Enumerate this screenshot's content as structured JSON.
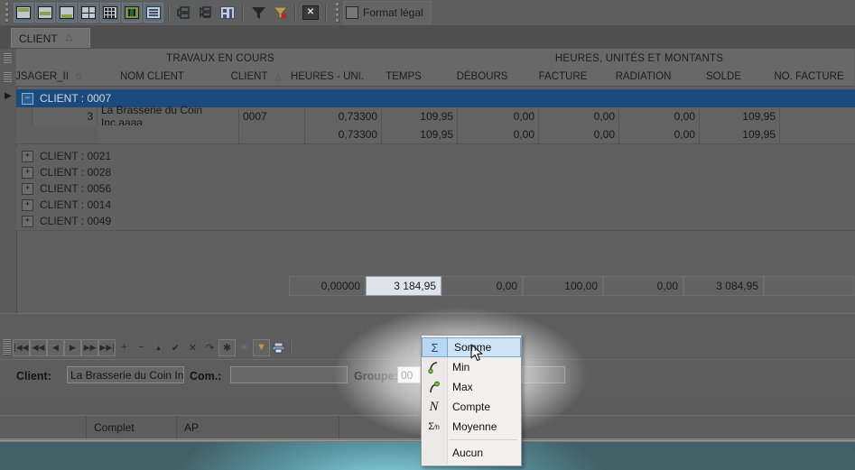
{
  "toolbar": {
    "icons": [
      {
        "name": "layout-top-band-icon",
        "framed": true
      },
      {
        "name": "layout-middle-band-icon",
        "framed": true
      },
      {
        "name": "layout-bottom-band-icon",
        "framed": true
      },
      {
        "name": "grid-quad-icon",
        "framed": true
      },
      {
        "name": "grid-dots-icon",
        "framed": true
      },
      {
        "name": "fit-width-icon",
        "framed": true
      },
      {
        "name": "list-lines-icon",
        "framed": true
      },
      {
        "name": "group-by-box-icon",
        "framed": false
      },
      {
        "name": "tree-outline-icon",
        "framed": false
      },
      {
        "name": "card-view-icon",
        "framed": false
      },
      {
        "name": "filter-icon",
        "framed": false
      },
      {
        "name": "filter-clear-icon",
        "framed": false
      },
      {
        "name": "close-x-icon",
        "framed": false
      }
    ],
    "format_legal_label": "Format légal",
    "format_legal_checked": false
  },
  "tab": {
    "label": "CLIENT",
    "sort_glyph": "△"
  },
  "grid": {
    "bands": [
      {
        "label": "TRAVAUX EN COURS"
      },
      {
        "label": "HEURES, UNITÉS  ET MONTANTS"
      }
    ],
    "columns": [
      {
        "label": "JSAGER_II",
        "sort": "▽",
        "align": "r"
      },
      {
        "label": "NOM CLIENT",
        "sort": "",
        "align": "l"
      },
      {
        "label": "CLIENT",
        "sort": "△",
        "align": "l"
      },
      {
        "label": "HEURES - UNI.",
        "sort": "",
        "align": "r"
      },
      {
        "label": "TEMPS",
        "sort": "",
        "align": "r"
      },
      {
        "label": "DÉBOURS",
        "sort": "",
        "align": "r"
      },
      {
        "label": "FACTURE",
        "sort": "",
        "align": "r"
      },
      {
        "label": "RADIATION",
        "sort": "",
        "align": "r"
      },
      {
        "label": "SOLDE",
        "sort": "",
        "align": "r"
      },
      {
        "label": "NO. FACTURE",
        "sort": "",
        "align": "r"
      }
    ],
    "expanded_group": {
      "label": "CLIENT : 0007",
      "expander": "−",
      "selected": true
    },
    "detail_row": {
      "cells": [
        "3",
        "La Brasserie du Coin Inc.aaaa",
        "0007",
        "0,73300",
        "109,95",
        "0,00",
        "0,00",
        "0,00",
        "109,95",
        ""
      ]
    },
    "group_total_row": {
      "cells": [
        "",
        "",
        "",
        "0,73300",
        "109,95",
        "0,00",
        "0,00",
        "0,00",
        "109,95",
        ""
      ]
    },
    "collapsed_groups": [
      {
        "label": "CLIENT : 0021",
        "expander": "+"
      },
      {
        "label": "CLIENT : 0028",
        "expander": "+"
      },
      {
        "label": "CLIENT : 0056",
        "expander": "+"
      },
      {
        "label": "CLIENT : 0014",
        "expander": "+"
      },
      {
        "label": "CLIENT : 0049",
        "expander": "+"
      }
    ],
    "footer_totals": {
      "cells": [
        "0,00000",
        "3 184,95",
        "0,00",
        "100,00",
        "0,00",
        "3 084,95",
        ""
      ],
      "active_index": 1
    }
  },
  "navbar": {
    "buttons": [
      {
        "name": "first-record-button",
        "glyph": "|◀◀",
        "framed": true
      },
      {
        "name": "prior-page-button",
        "glyph": "◀◀",
        "framed": true
      },
      {
        "name": "prior-record-button",
        "glyph": "◀",
        "framed": true
      },
      {
        "name": "next-record-button",
        "glyph": "▶",
        "framed": true
      },
      {
        "name": "next-page-button",
        "glyph": "▶▶",
        "framed": true
      },
      {
        "name": "last-record-button",
        "glyph": "▶▶|",
        "framed": true
      },
      {
        "name": "insert-record-button",
        "glyph": "+",
        "framed": false
      },
      {
        "name": "delete-record-button",
        "glyph": "−",
        "framed": false
      },
      {
        "name": "edit-record-button",
        "glyph": "▲",
        "framed": false
      },
      {
        "name": "post-edit-button",
        "glyph": "✔",
        "framed": false
      },
      {
        "name": "cancel-edit-button",
        "glyph": "✕",
        "framed": false
      },
      {
        "name": "refresh-button",
        "glyph": "↷",
        "framed": false
      },
      {
        "name": "select-all-button",
        "glyph": "✱",
        "framed": true
      },
      {
        "name": "clear-selection-button",
        "glyph": "✳",
        "framed": false
      },
      {
        "name": "filter-toggle-button",
        "glyph": "▼",
        "framed": true
      },
      {
        "name": "print-button",
        "glyph": "🖶",
        "framed": false
      }
    ],
    "collapse_glyph": "‹"
  },
  "detail_form": {
    "client_label": "Client:",
    "client_value": "La Brasserie du Coin Inc.a",
    "com_label": "Com.:",
    "com_value": "",
    "groupe_label": "Groupe:",
    "groupe_value": "00",
    "extra_value": ""
  },
  "statusbar": {
    "segments": [
      "",
      "Complet",
      "AP",
      ""
    ]
  },
  "context_menu": {
    "items": [
      {
        "icon": "sigma-icon",
        "glyph": "Σ",
        "label": "Somme",
        "selected": true
      },
      {
        "icon": "min-arrow-icon",
        "glyph": "↘",
        "label": "Min",
        "selected": false
      },
      {
        "icon": "max-arrow-icon",
        "glyph": "↗",
        "label": "Max",
        "selected": false
      },
      {
        "icon": "count-n-icon",
        "glyph": "N",
        "label": "Compte",
        "selected": false
      },
      {
        "icon": "average-sigma-n-icon",
        "glyph": "Σ⁄ₙ",
        "label": "Moyenne",
        "selected": false
      }
    ],
    "none_item": {
      "label": "Aucun"
    }
  },
  "colors": {
    "window_bg": "#5c5c5c",
    "header_bg": "#686868",
    "selection_blue": "#1c4a7d",
    "menu_bg": "#f2f1f0",
    "menu_selection": "#cfe4f7",
    "desktop": "#3f5a60"
  }
}
